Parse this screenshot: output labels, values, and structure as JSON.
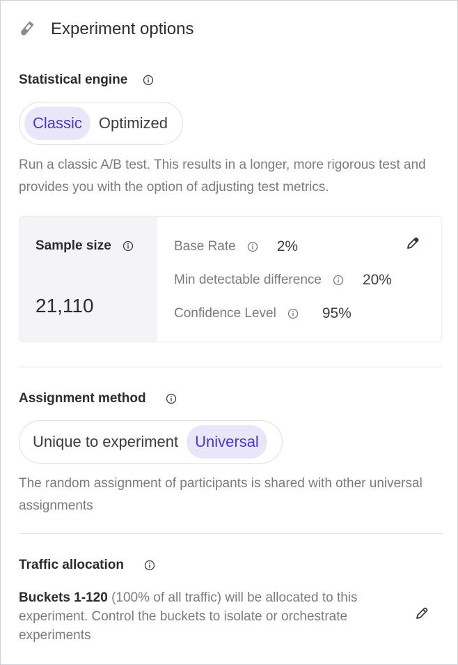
{
  "header": {
    "title": "Experiment options",
    "icon": "flask-icon"
  },
  "statistical_engine": {
    "title": "Statistical engine",
    "options": [
      "Classic",
      "Optimized"
    ],
    "selected": "Classic",
    "description": "Run a classic A/B test. This results in a longer, more rigorous test and provides you with the option of adjusting test metrics."
  },
  "sample_size": {
    "label": "Sample size",
    "value": "21,110",
    "metrics": [
      {
        "label": "Base Rate",
        "value": "2%"
      },
      {
        "label": "Min detectable difference",
        "value": "20%"
      },
      {
        "label": "Confidence Level",
        "value": "95%"
      }
    ]
  },
  "assignment_method": {
    "title": "Assignment method",
    "options": [
      "Unique to experiment",
      "Universal"
    ],
    "selected": "Universal",
    "description": "The random assignment of participants is shared with other universal assignments"
  },
  "traffic_allocation": {
    "title": "Traffic allocation",
    "buckets": "Buckets 1-120",
    "text": " (100% of all traffic) will be allocated to this experiment. Control the buckets to isolate or orchestrate experiments"
  },
  "colors": {
    "accent": "#4a38c4",
    "accent_bg": "#e9e6fa",
    "muted_text": "#7a7a82"
  }
}
